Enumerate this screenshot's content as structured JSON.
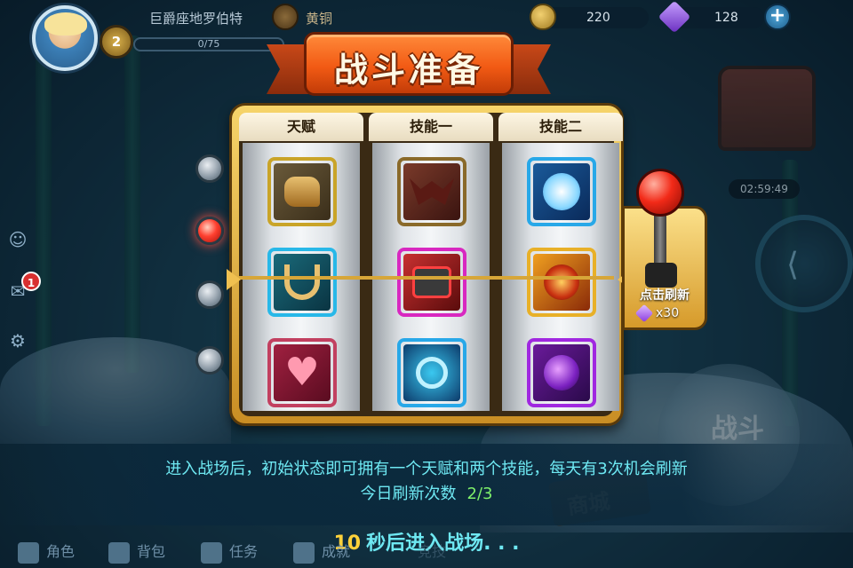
{
  "topbar": {
    "player_name": "巨爵座地罗伯特",
    "level": "2",
    "rank": "黄铜",
    "exp": "0/75",
    "coins": "220",
    "gems": "128",
    "plus": "+"
  },
  "side": {
    "mail_badge": "1"
  },
  "right": {
    "timer": "02:59:49",
    "battle": "战斗",
    "shop": "商城"
  },
  "dialog": {
    "title": "战斗准备",
    "columns": [
      {
        "label": "天赋",
        "skills": [
          "winged-boot-icon",
          "slingshot-icon",
          "heart-heal-icon"
        ]
      },
      {
        "label": "技能一",
        "skills": [
          "bat-icon",
          "time-bomb-icon",
          "vortex-icon"
        ]
      },
      {
        "label": "技能二",
        "skills": [
          "ice-ball-icon",
          "fire-rock-icon",
          "shadow-orb-icon"
        ]
      }
    ],
    "lever_label": "点击刷新",
    "lever_cost": "x30"
  },
  "info": {
    "line1": "进入战场后，初始状态即可拥有一个天赋和两个技能，每天有3次机会刷新",
    "refresh_label": "今日刷新次数",
    "refresh_count": "2/3"
  },
  "countdown": {
    "seconds": "10",
    "text": "秒后进入战场. . ."
  },
  "bottom_nav": {
    "items": [
      "角色",
      "背包",
      "任务",
      "成就"
    ],
    "hidden_item": "竞技"
  },
  "colors": {
    "accent_cyan": "#6ee8f2",
    "banner_orange": "#f25a14",
    "frame_gold": "#d7a638",
    "count_green": "#7ef06a",
    "countdown_yellow": "#ffd23a"
  }
}
